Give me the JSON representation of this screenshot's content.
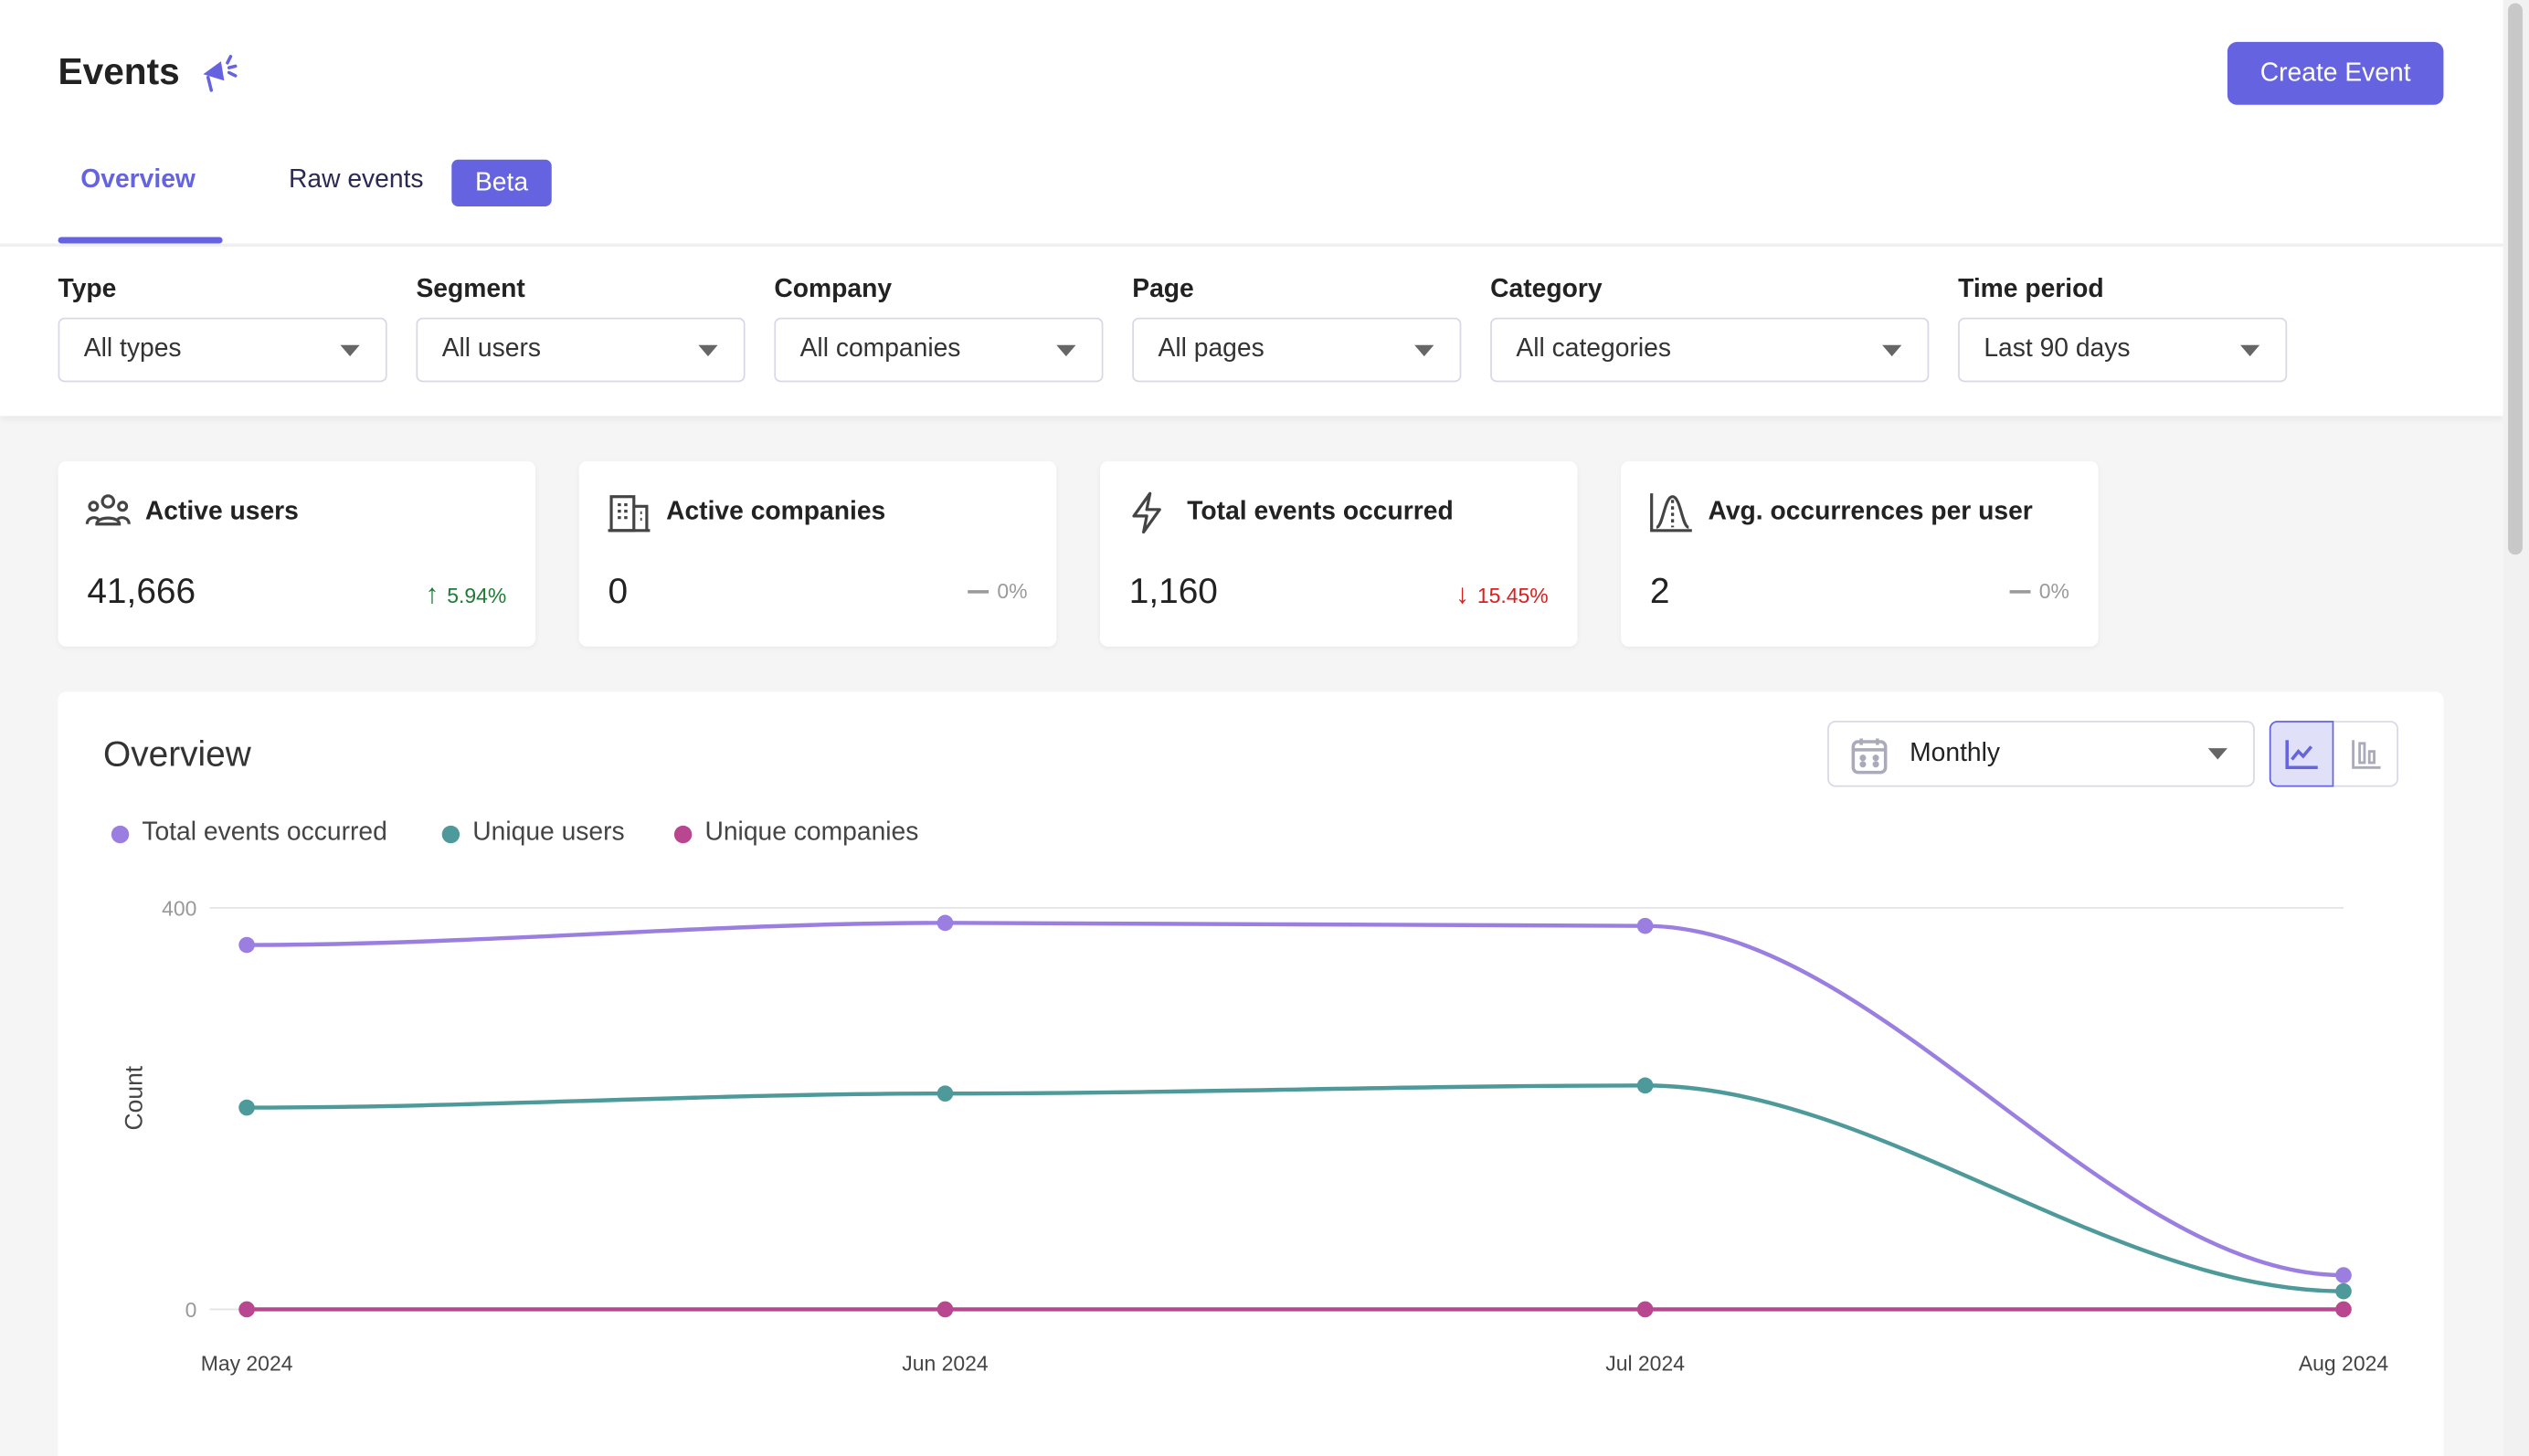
{
  "header": {
    "title": "Events",
    "title_icon": "megaphone-icon",
    "create_button": "Create Event"
  },
  "tabs": [
    {
      "label": "Overview",
      "active": true
    },
    {
      "label": "Raw events",
      "active": false,
      "badge": "Beta"
    }
  ],
  "filters": [
    {
      "label": "Type",
      "value": "All types"
    },
    {
      "label": "Segment",
      "value": "All users"
    },
    {
      "label": "Company",
      "value": "All companies"
    },
    {
      "label": "Page",
      "value": "All pages"
    },
    {
      "label": "Category",
      "value": "All categories"
    },
    {
      "label": "Time period",
      "value": "Last 90 days"
    }
  ],
  "stats": [
    {
      "label": "Active users",
      "value": "41,666",
      "change": "5.94%",
      "trend": "up",
      "icon": "users-icon"
    },
    {
      "label": "Active companies",
      "value": "0",
      "change": "0%",
      "trend": "flat",
      "icon": "building-icon"
    },
    {
      "label": "Total events occurred",
      "value": "1,160",
      "change": "15.45%",
      "trend": "down",
      "icon": "lightning-icon"
    },
    {
      "label": "Avg. occurrences per user",
      "value": "2",
      "change": "0%",
      "trend": "flat",
      "icon": "distribution-icon"
    }
  ],
  "colors": {
    "accent": "#6563e0",
    "up": "#1e7b34",
    "down": "#d92020",
    "flat": "#9a9a9a"
  },
  "overview": {
    "title": "Overview",
    "interval": "Monthly",
    "chart_mode": "line"
  },
  "chart_data": {
    "type": "line",
    "ylabel": "Count",
    "ylim": [
      0,
      400
    ],
    "yticks": [
      "0",
      "400"
    ],
    "categories": [
      "May 2024",
      "Jun 2024",
      "Jul 2024",
      "Aug 2024"
    ],
    "legend_position": "top-left",
    "series": [
      {
        "name": "Total events occurred",
        "color": "#9b7fe0",
        "values": [
          363,
          385,
          382,
          34
        ]
      },
      {
        "name": "Unique users",
        "color": "#4e9a9a",
        "values": [
          201,
          215,
          223,
          18
        ]
      },
      {
        "name": "Unique companies",
        "color": "#b8478f",
        "values": [
          0,
          0,
          0,
          0
        ]
      }
    ]
  }
}
